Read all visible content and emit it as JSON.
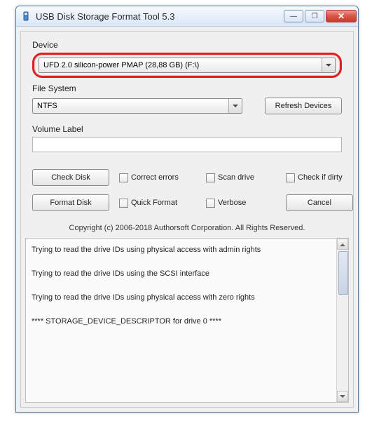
{
  "window": {
    "title": "USB Disk Storage Format Tool 5.3"
  },
  "labels": {
    "device": "Device",
    "file_system": "File System",
    "volume_label": "Volume Label"
  },
  "device": {
    "selected": "UFD 2.0  silicon-power  PMAP (28,88 GB) (F:\\)"
  },
  "file_system": {
    "selected": "NTFS"
  },
  "volume_label": {
    "value": ""
  },
  "buttons": {
    "refresh": "Refresh Devices",
    "check_disk": "Check Disk",
    "format_disk": "Format Disk",
    "cancel": "Cancel"
  },
  "checkboxes": {
    "correct_errors": "Correct errors",
    "scan_drive": "Scan drive",
    "check_if_dirty": "Check if dirty",
    "quick_format": "Quick Format",
    "verbose": "Verbose"
  },
  "copyright": "Copyright (c) 2006-2018 Authorsoft Corporation. All Rights Reserved.",
  "log": [
    "Trying to read the drive IDs using physical access with admin rights",
    "Trying to read the drive IDs using the SCSI interface",
    "Trying to read the drive IDs using physical access with zero rights",
    "**** STORAGE_DEVICE_DESCRIPTOR for drive 0 ****"
  ]
}
